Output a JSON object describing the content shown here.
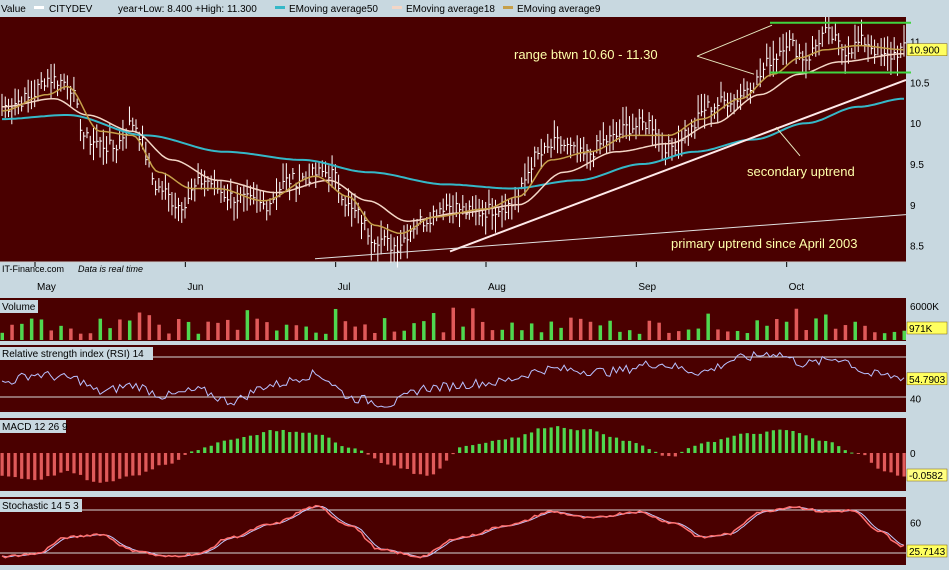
{
  "colors": {
    "panel_bg": "#4a0000",
    "frame_bg": "#c8d8e0",
    "price": "#ffffff",
    "ema50": "#35b8c8",
    "ema18": "#f4d6c6",
    "ema9": "#c6a04a",
    "up": "#4fd84f",
    "down": "#e05a5a",
    "rsi": "#b8c0ff",
    "stoch_k": "#ff7070",
    "stoch_d": "#c0c8ff",
    "annot": "#ffffaa",
    "range_line": "#3fd53f",
    "current_badge": "#ffff60"
  },
  "legend": {
    "value_label": "Value",
    "symbol": "CITYDEV",
    "range_text": "year+Low: 8.400 +High: 11.300",
    "ema50": "EMoving average50",
    "ema18": "EMoving average18",
    "ema9": "EMoving average9"
  },
  "annotations": {
    "range": "range btwn 10.60 - 11.30",
    "secondary": "secondary uptrend",
    "primary": "primary uptrend since April 2003"
  },
  "credit": {
    "site": "IT-Finance.com",
    "note": "Data is real time"
  },
  "chart_data": [
    {
      "type": "line",
      "panel": "price",
      "title": "CITYDEV",
      "x": [
        "May",
        "Jun",
        "Jul",
        "Aug",
        "Sep",
        "Oct"
      ],
      "ylim": [
        8.3,
        11.3
      ],
      "y_ticks": [
        "11",
        "10.5",
        "10",
        "9.5",
        "9",
        "8.5"
      ],
      "current_value": "10.900",
      "series": [
        {
          "name": "CITYDEV",
          "anchors": [
            [
              0,
              10.2
            ],
            [
              8,
              10.3
            ],
            [
              14,
              10.55
            ],
            [
              20,
              10.5
            ],
            [
              26,
              9.8
            ],
            [
              34,
              9.7
            ],
            [
              40,
              10.0
            ],
            [
              48,
              9.2
            ],
            [
              54,
              9.0
            ],
            [
              62,
              9.3
            ],
            [
              70,
              9.1
            ],
            [
              80,
              9.0
            ],
            [
              88,
              9.3
            ],
            [
              100,
              9.4
            ],
            [
              108,
              8.9
            ],
            [
              114,
              8.6
            ],
            [
              120,
              8.5
            ],
            [
              128,
              8.8
            ],
            [
              136,
              9.0
            ],
            [
              144,
              8.9
            ],
            [
              156,
              9.0
            ],
            [
              164,
              9.6
            ],
            [
              170,
              9.75
            ],
            [
              178,
              9.6
            ],
            [
              186,
              9.8
            ],
            [
              192,
              9.95
            ],
            [
              198,
              10.0
            ],
            [
              204,
              9.7
            ],
            [
              210,
              9.9
            ],
            [
              216,
              10.2
            ],
            [
              224,
              10.3
            ],
            [
              230,
              10.5
            ],
            [
              236,
              10.8
            ],
            [
              240,
              11.0
            ],
            [
              246,
              10.8
            ],
            [
              252,
              11.1
            ],
            [
              258,
              10.9
            ],
            [
              264,
              11.0
            ],
            [
              270,
              10.8
            ],
            [
              276,
              10.9
            ]
          ]
        },
        {
          "name": "EMoving average9",
          "anchors": [
            [
              0,
              10.15
            ],
            [
              14,
              10.35
            ],
            [
              20,
              10.45
            ],
            [
              30,
              9.9
            ],
            [
              40,
              9.85
            ],
            [
              48,
              9.4
            ],
            [
              58,
              9.2
            ],
            [
              66,
              9.2
            ],
            [
              80,
              9.05
            ],
            [
              96,
              9.35
            ],
            [
              106,
              9.1
            ],
            [
              114,
              8.75
            ],
            [
              122,
              8.65
            ],
            [
              132,
              8.85
            ],
            [
              148,
              8.95
            ],
            [
              158,
              9.1
            ],
            [
              168,
              9.55
            ],
            [
              180,
              9.65
            ],
            [
              192,
              9.85
            ],
            [
              204,
              9.85
            ],
            [
              214,
              10.05
            ],
            [
              226,
              10.3
            ],
            [
              236,
              10.6
            ],
            [
              244,
              10.8
            ],
            [
              252,
              10.9
            ],
            [
              262,
              10.95
            ],
            [
              276,
              10.9
            ]
          ]
        },
        {
          "name": "EMoving average18",
          "anchors": [
            [
              0,
              10.2
            ],
            [
              16,
              10.3
            ],
            [
              26,
              10.1
            ],
            [
              40,
              9.9
            ],
            [
              52,
              9.55
            ],
            [
              66,
              9.3
            ],
            [
              84,
              9.15
            ],
            [
              100,
              9.3
            ],
            [
              112,
              9.05
            ],
            [
              124,
              8.8
            ],
            [
              140,
              8.9
            ],
            [
              158,
              9.0
            ],
            [
              172,
              9.4
            ],
            [
              188,
              9.65
            ],
            [
              204,
              9.75
            ],
            [
              218,
              10.0
            ],
            [
              232,
              10.35
            ],
            [
              244,
              10.6
            ],
            [
              256,
              10.75
            ],
            [
              276,
              10.85
            ]
          ]
        },
        {
          "name": "EMoving average50",
          "anchors": [
            [
              0,
              10.05
            ],
            [
              20,
              10.1
            ],
            [
              44,
              9.85
            ],
            [
              68,
              9.65
            ],
            [
              92,
              9.55
            ],
            [
              112,
              9.4
            ],
            [
              136,
              9.25
            ],
            [
              156,
              9.2
            ],
            [
              176,
              9.3
            ],
            [
              196,
              9.5
            ],
            [
              212,
              9.65
            ],
            [
              230,
              9.8
            ],
            [
              246,
              10.0
            ],
            [
              262,
              10.2
            ],
            [
              276,
              10.3
            ]
          ]
        }
      ]
    },
    {
      "type": "bar",
      "panel": "volume",
      "title": "Volume",
      "y_ticks": [
        "6000K"
      ],
      "current_value": "971K"
    },
    {
      "type": "line",
      "panel": "rsi",
      "title": "Relative strength index (RSI) 14",
      "ylim": [
        30,
        80
      ],
      "y_ticks": [
        "40"
      ],
      "current_value": "54.7903",
      "anchors": [
        [
          0,
          52
        ],
        [
          10,
          58
        ],
        [
          22,
          55
        ],
        [
          30,
          45
        ],
        [
          40,
          50
        ],
        [
          50,
          42
        ],
        [
          60,
          46
        ],
        [
          70,
          38
        ],
        [
          82,
          50
        ],
        [
          96,
          58
        ],
        [
          108,
          40
        ],
        [
          118,
          36
        ],
        [
          130,
          48
        ],
        [
          150,
          52
        ],
        [
          168,
          62
        ],
        [
          186,
          60
        ],
        [
          200,
          66
        ],
        [
          214,
          60
        ],
        [
          226,
          70
        ],
        [
          236,
          74
        ],
        [
          246,
          66
        ],
        [
          256,
          70
        ],
        [
          266,
          58
        ],
        [
          276,
          56
        ]
      ]
    },
    {
      "type": "bar",
      "panel": "macd",
      "title": "MACD 12 26 9",
      "current_value": "-0.0582",
      "y_ticks": [
        "0"
      ],
      "anchors": [
        [
          0,
          -0.06
        ],
        [
          10,
          -0.07
        ],
        [
          20,
          -0.05
        ],
        [
          30,
          -0.08
        ],
        [
          40,
          -0.06
        ],
        [
          50,
          -0.03
        ],
        [
          60,
          0.01
        ],
        [
          72,
          0.04
        ],
        [
          84,
          0.06
        ],
        [
          96,
          0.05
        ],
        [
          108,
          0.01
        ],
        [
          118,
          -0.03
        ],
        [
          130,
          -0.06
        ],
        [
          142,
          0.02
        ],
        [
          156,
          0.04
        ],
        [
          168,
          0.07
        ],
        [
          180,
          0.06
        ],
        [
          192,
          0.03
        ],
        [
          204,
          -0.01
        ],
        [
          216,
          0.03
        ],
        [
          228,
          0.05
        ],
        [
          240,
          0.06
        ],
        [
          252,
          0.03
        ],
        [
          262,
          0.0
        ],
        [
          270,
          -0.05
        ],
        [
          276,
          -0.06
        ]
      ]
    },
    {
      "type": "line",
      "panel": "stochastic",
      "title": "Stochastic 14 5 3",
      "ylim": [
        0,
        100
      ],
      "y_ticks": [
        "60"
      ],
      "current_value": "25.7143",
      "anchors": [
        [
          0,
          10
        ],
        [
          10,
          14
        ],
        [
          20,
          40
        ],
        [
          30,
          45
        ],
        [
          40,
          20
        ],
        [
          50,
          10
        ],
        [
          60,
          14
        ],
        [
          70,
          40
        ],
        [
          82,
          60
        ],
        [
          96,
          88
        ],
        [
          106,
          60
        ],
        [
          116,
          20
        ],
        [
          128,
          10
        ],
        [
          140,
          40
        ],
        [
          156,
          60
        ],
        [
          168,
          80
        ],
        [
          180,
          70
        ],
        [
          194,
          80
        ],
        [
          206,
          62
        ],
        [
          214,
          40
        ],
        [
          222,
          45
        ],
        [
          232,
          80
        ],
        [
          242,
          88
        ],
        [
          252,
          80
        ],
        [
          260,
          82
        ],
        [
          268,
          50
        ],
        [
          276,
          26
        ]
      ]
    }
  ]
}
